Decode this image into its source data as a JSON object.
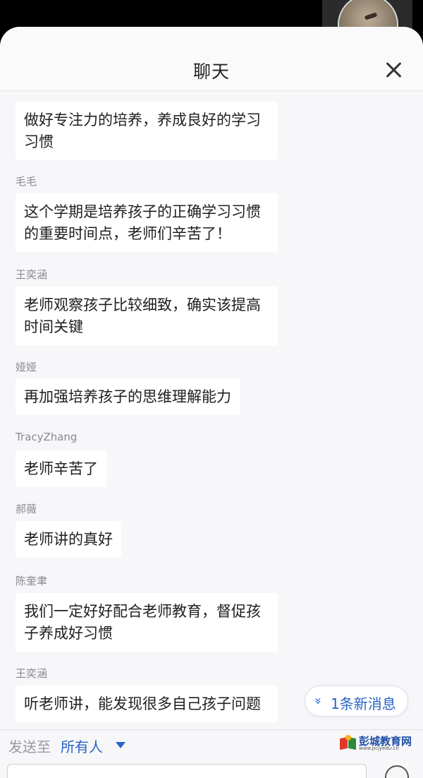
{
  "header": {
    "title": "聊天"
  },
  "messages": [
    {
      "sender": "",
      "text": "做好专注力的培养，养成良好的学习习惯"
    },
    {
      "sender": "毛毛",
      "text": "这个学期是培养孩子的正确学习习惯的重要时间点，老师们辛苦了！"
    },
    {
      "sender": "王奕涵",
      "text": "老师观察孩子比较细致，确实该提高时间关键"
    },
    {
      "sender": "娅娅",
      "text": "再加强培养孩子的思维理解能力"
    },
    {
      "sender": "TracyZhang",
      "text": "老师辛苦了"
    },
    {
      "sender": "郝薇",
      "text": "老师讲的真好"
    },
    {
      "sender": "陈奎聿",
      "text": "我们一定好好配合老师教育，督促孩子养成好习惯"
    },
    {
      "sender": "王奕涵",
      "text": "听老师讲，能发现很多自己孩子问题"
    }
  ],
  "new_messages_badge": {
    "chevron": "»",
    "label": "1条新消息"
  },
  "footer": {
    "send_to_label": "发送至",
    "recipient": "所有人"
  },
  "watermark": {
    "name": "彭城教育网",
    "url": "www.pcjyedu.cn"
  },
  "icons": {
    "close": "close-icon",
    "dropdown": "caret-down-icon",
    "emoji": "emoji-icon"
  },
  "colors": {
    "accent": "#2a63c5",
    "background": "#f7f7f9",
    "bubble": "#ffffff",
    "sender_text": "#8a8a8e"
  }
}
